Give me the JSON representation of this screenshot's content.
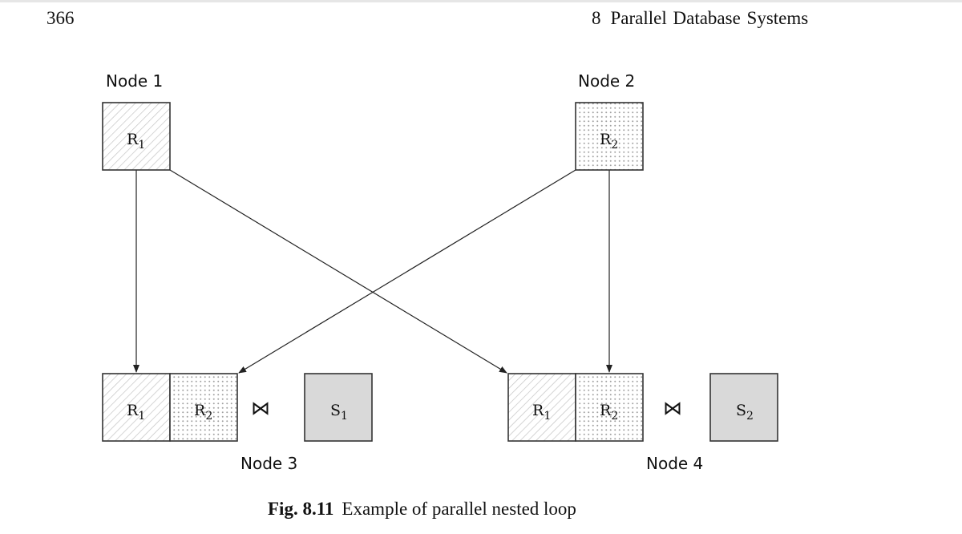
{
  "header": {
    "page_number": "366",
    "chapter_number": "8",
    "chapter_title": "Parallel Database Systems"
  },
  "figure": {
    "nodes": [
      {
        "label": "Node 1"
      },
      {
        "label": "Node 2"
      },
      {
        "label": "Node 3"
      },
      {
        "label": "Node 4"
      }
    ],
    "relations": {
      "r1": {
        "base": "R",
        "sub": "1"
      },
      "r2": {
        "base": "R",
        "sub": "2"
      },
      "s1": {
        "base": "S",
        "sub": "1"
      },
      "s2": {
        "base": "S",
        "sub": "2"
      }
    },
    "join_symbol": "⋈",
    "caption_label": "Fig. 8.11",
    "caption_text": "Example of parallel nested loop"
  },
  "colors": {
    "stroke": "#333333",
    "hatch": "#bdbdbd",
    "dots": "#9a9a9a",
    "s_fill": "#d9d9d9"
  }
}
